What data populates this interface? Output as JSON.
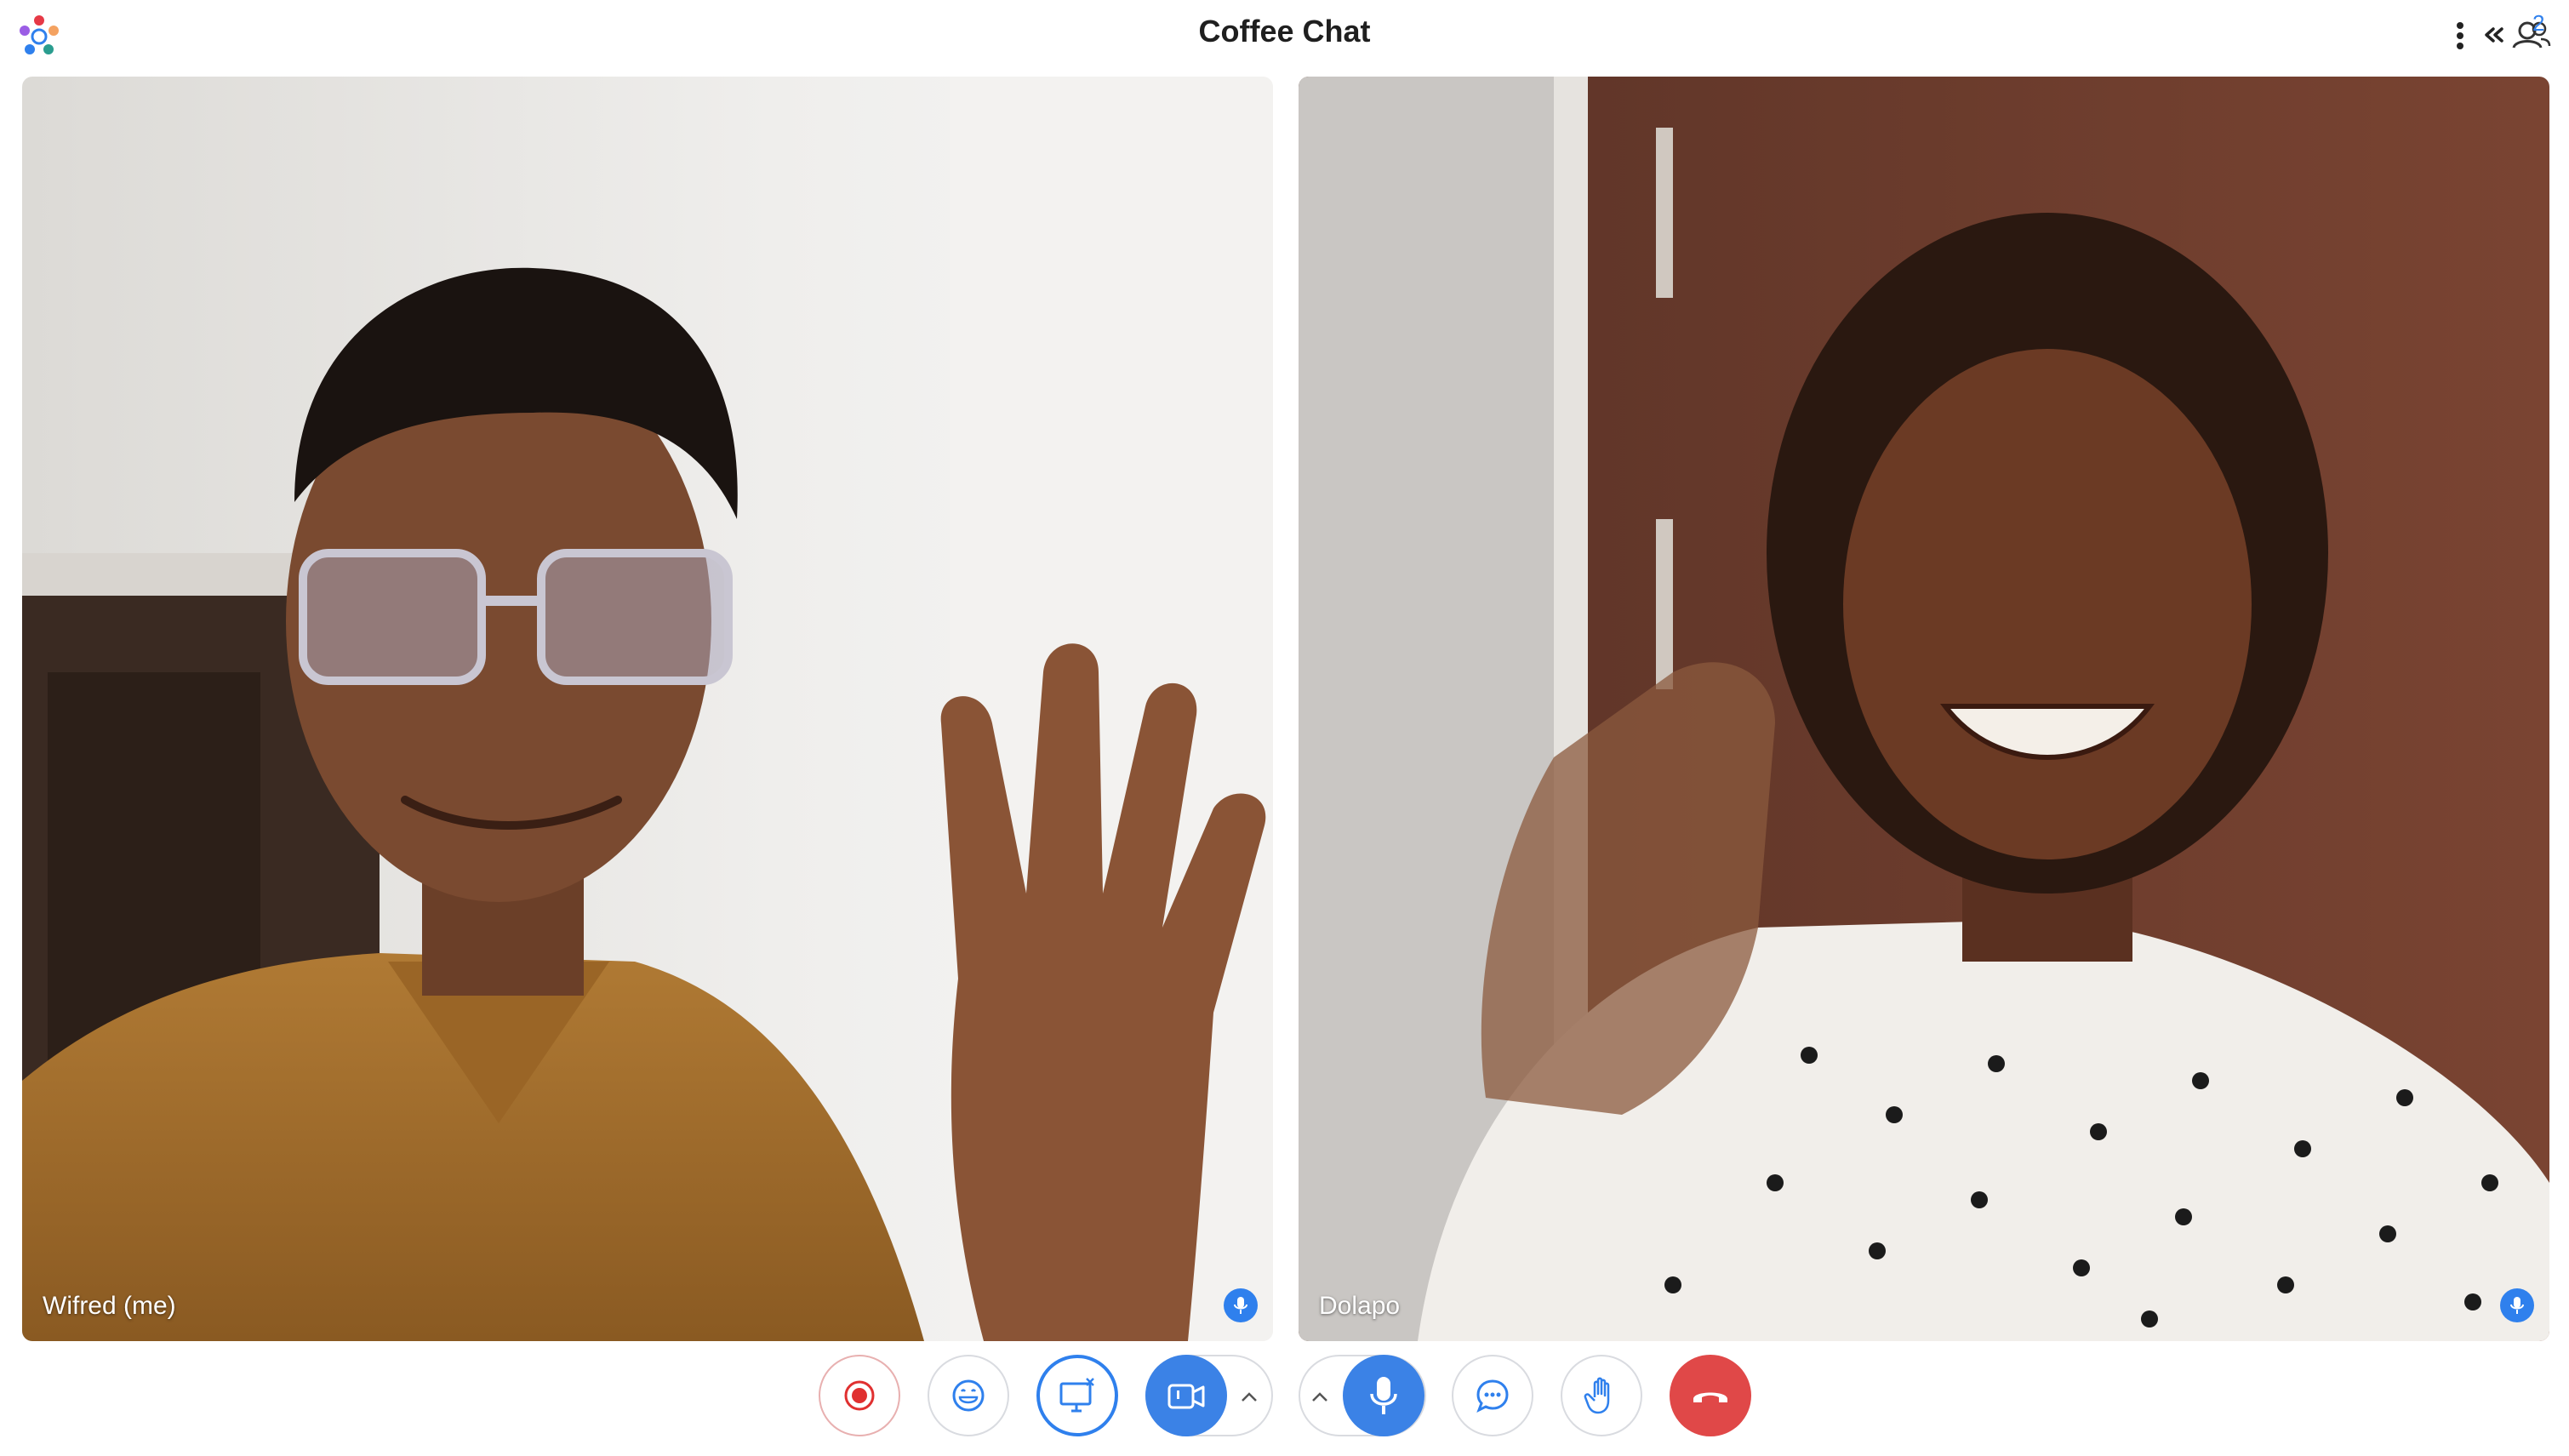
{
  "window": {
    "title": "Coffee Chat",
    "participants_count": "2"
  },
  "participants": [
    {
      "name": "Wifred (me)",
      "mic": "on"
    },
    {
      "name": "Dolapo",
      "mic": "on"
    }
  ],
  "controls": [
    {
      "id": "record",
      "icon": "record-icon"
    },
    {
      "id": "reactions",
      "icon": "emoji-icon"
    },
    {
      "id": "screen-share",
      "icon": "screen-share-icon"
    },
    {
      "id": "camera",
      "icon": "video-camera-icon",
      "state": "on"
    },
    {
      "id": "microphone",
      "icon": "microphone-icon",
      "state": "on"
    },
    {
      "id": "chat",
      "icon": "chat-icon"
    },
    {
      "id": "raise-hand",
      "icon": "hand-icon"
    },
    {
      "id": "end-call",
      "icon": "phone-hangup-icon"
    }
  ],
  "colors": {
    "accent": "#2f80ed",
    "end_call": "#e04848",
    "record": "#e03030"
  }
}
